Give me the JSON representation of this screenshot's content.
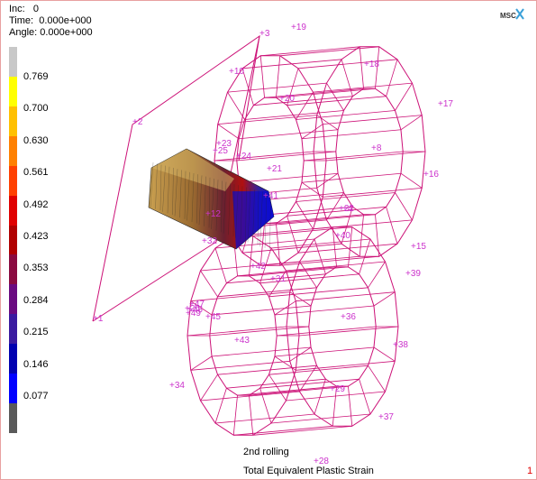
{
  "header": {
    "inc": "Inc:   0",
    "time": "Time:  0.000e+000",
    "angle": "Angle: 0.000e+000"
  },
  "logo_text": "MSC",
  "legend": {
    "ticks": [
      "0.769",
      "0.700",
      "0.630",
      "0.561",
      "0.492",
      "0.423",
      "0.353",
      "0.284",
      "0.215",
      "0.146",
      "0.077"
    ],
    "colors": [
      "#5a5a5a",
      "#0000ff",
      "#0000b0",
      "#3a1aa0",
      "#6a0a80",
      "#8a0a40",
      "#b00000",
      "#e00000",
      "#ff4000",
      "#ff8000",
      "#ffc000",
      "#ffff00",
      "#c8c8c8"
    ]
  },
  "node_labels": [
    "1",
    "2",
    "3",
    "4",
    "8",
    "10",
    "12",
    "15",
    "16",
    "17",
    "18",
    "19",
    "20",
    "21",
    "22",
    "23",
    "24",
    "25",
    "26",
    "28",
    "29",
    "31",
    "32",
    "34",
    "36",
    "37",
    "38",
    "39",
    "40",
    "41",
    "42",
    "43",
    "45",
    "47",
    "48",
    "49"
  ],
  "footer": {
    "line1": "2nd rolling",
    "line2": "Total Equivalent Plastic Strain",
    "page": "1"
  },
  "colors": {
    "mesh": "#cc1177",
    "labels": "#cc33cc",
    "caption": "#000000",
    "page_number": "#e00000"
  }
}
